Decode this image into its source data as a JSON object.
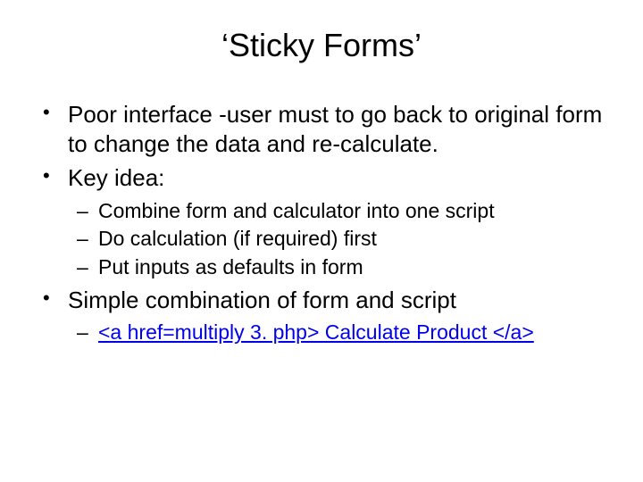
{
  "title": "‘Sticky Forms’",
  "bullets": {
    "b1": "Poor interface  -user must to go back to original form to change the data and re-calculate.",
    "b2": "Key idea:",
    "b2_sub": {
      "s1": "Combine form and calculator into one script",
      "s2": "Do calculation (if required) first",
      "s3": "Put inputs as defaults in form"
    },
    "b3": "Simple combination of form and script",
    "b3_sub": {
      "s1": "<a href=multiply 3. php> Calculate Product </a>"
    }
  }
}
